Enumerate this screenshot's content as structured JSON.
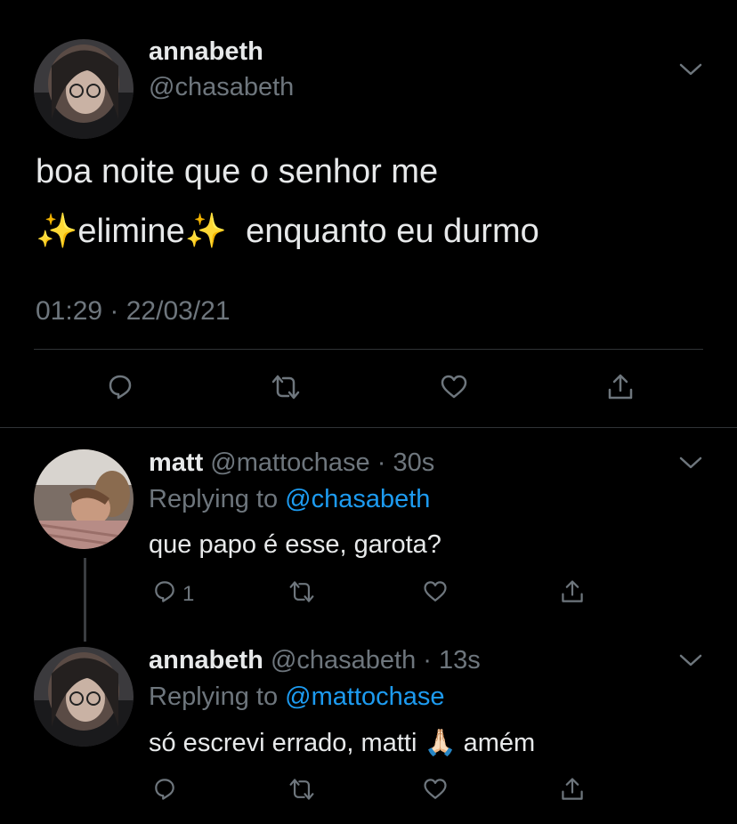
{
  "main_tweet": {
    "display_name": "annabeth",
    "handle": "@chasabeth",
    "text_line1": "boa noite que o senhor me",
    "text_line2_prefix": "✨elimine✨",
    "text_line2_suffix": "enquanto eu durmo",
    "timestamp": "01:29 · 22/03/21",
    "avatar": "avatar-photo",
    "actions": [
      "reply-icon",
      "retweet-icon",
      "like-icon",
      "share-icon"
    ]
  },
  "replies": [
    {
      "display_name": "matt",
      "handle": "@mattochase",
      "time": "30s",
      "replying_label": "Replying to",
      "replying_to": "@chasabeth",
      "text": "que papo é esse, garota?",
      "reply_count": "1"
    },
    {
      "display_name": "annabeth",
      "handle": "@chasabeth",
      "time": "13s",
      "replying_label": "Replying to",
      "replying_to": "@mattochase",
      "text_prefix": "só escrevi errado, matti",
      "emoji": "🙏🏻",
      "text_suffix": "amém"
    }
  ],
  "colors": {
    "background": "#000000",
    "text": "#e7e9ea",
    "muted": "#6e767d",
    "link": "#1d9bf0",
    "divider": "#2f3336"
  }
}
